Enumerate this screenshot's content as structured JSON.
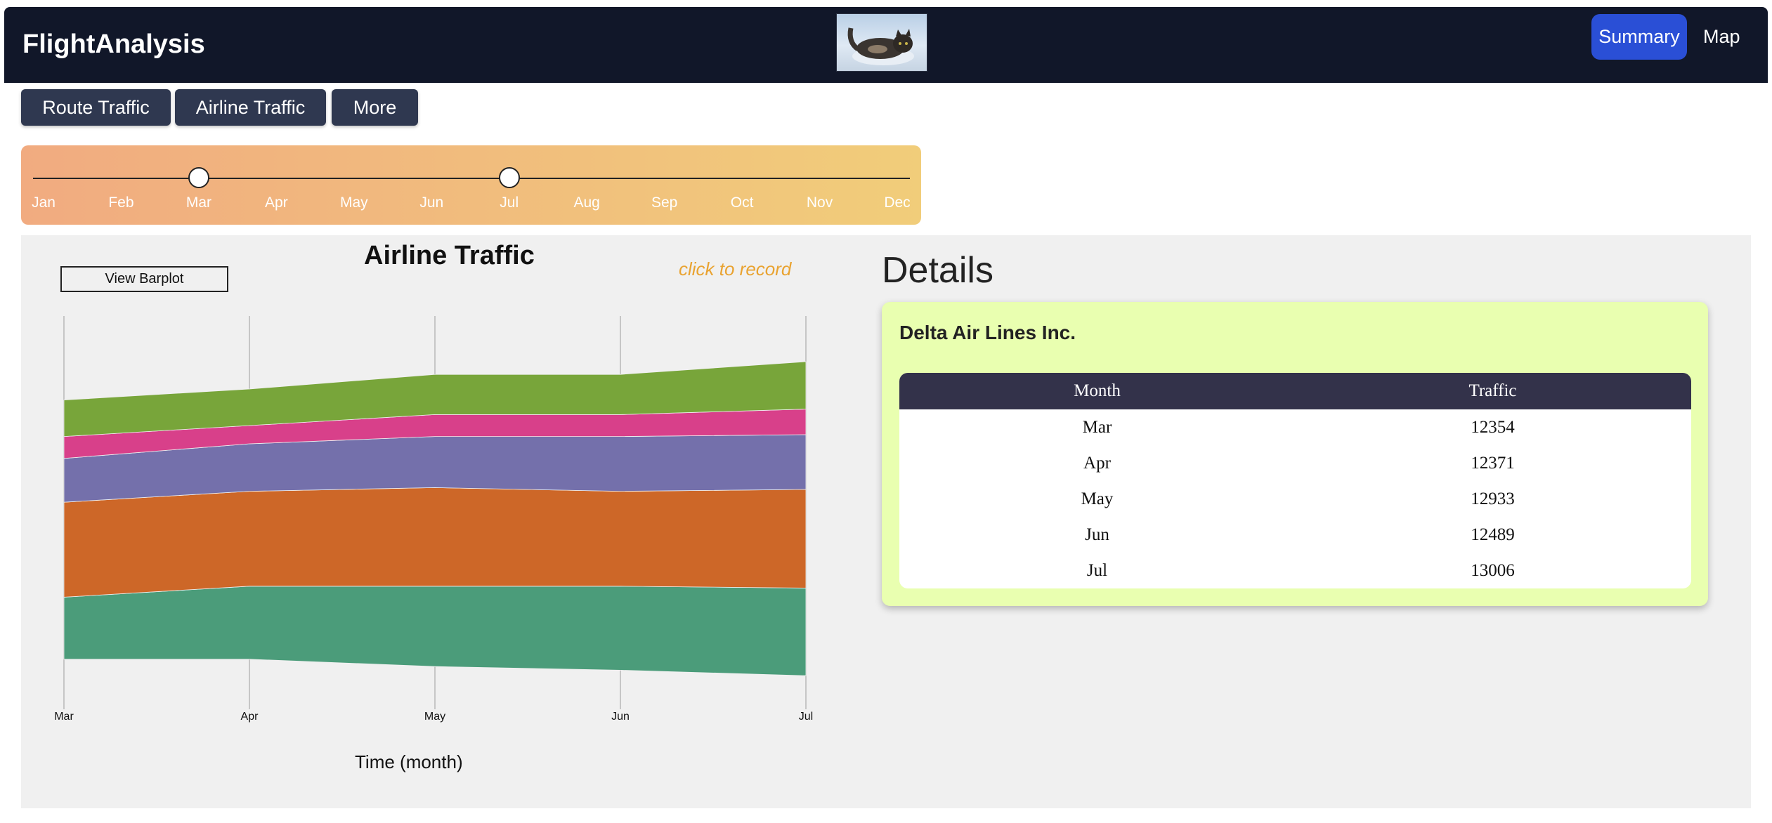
{
  "navbar": {
    "brand": "FlightAnalysis",
    "summary_label": "Summary",
    "map_label": "Map"
  },
  "tabs": {
    "route": "Route Traffic",
    "airline": "Airline Traffic",
    "more": "More"
  },
  "slider": {
    "months": [
      "Jan",
      "Feb",
      "Mar",
      "Apr",
      "May",
      "Jun",
      "Jul",
      "Aug",
      "Sep",
      "Oct",
      "Nov",
      "Dec"
    ],
    "start": "Mar",
    "end": "Jul",
    "colors": {
      "left": "#f1ab80",
      "right": "#f1cd7a"
    }
  },
  "chart": {
    "title": "Airline Traffic",
    "record_label": "click to record",
    "barplot_button": "View Barplot",
    "xlabel": "Time (month)"
  },
  "chart_data": {
    "type": "area",
    "stacked": true,
    "x": [
      "Mar",
      "Apr",
      "May",
      "Jun",
      "Jul"
    ],
    "series": [
      {
        "color": "#4b9c7a",
        "values": [
          17,
          20,
          22,
          23,
          24
        ]
      },
      {
        "color": "#cd6728",
        "values": [
          26,
          26,
          27,
          26,
          27
        ]
      },
      {
        "color": "#7470ab",
        "values": [
          12,
          13,
          14,
          15,
          15
        ]
      },
      {
        "color": "#d8408a",
        "values": [
          6,
          5,
          6,
          6,
          7
        ]
      },
      {
        "color": "#78a53a",
        "values": [
          10,
          10,
          11,
          11,
          13
        ]
      }
    ],
    "ylim": [
      0,
      100
    ],
    "grid": true
  },
  "details": {
    "title": "Details",
    "airline": "Delta Air Lines Inc.",
    "columns": [
      "Month",
      "Traffic"
    ],
    "rows": [
      [
        "Mar",
        "12354"
      ],
      [
        "Apr",
        "12371"
      ],
      [
        "May",
        "12933"
      ],
      [
        "Jun",
        "12489"
      ],
      [
        "Jul",
        "13006"
      ]
    ]
  }
}
